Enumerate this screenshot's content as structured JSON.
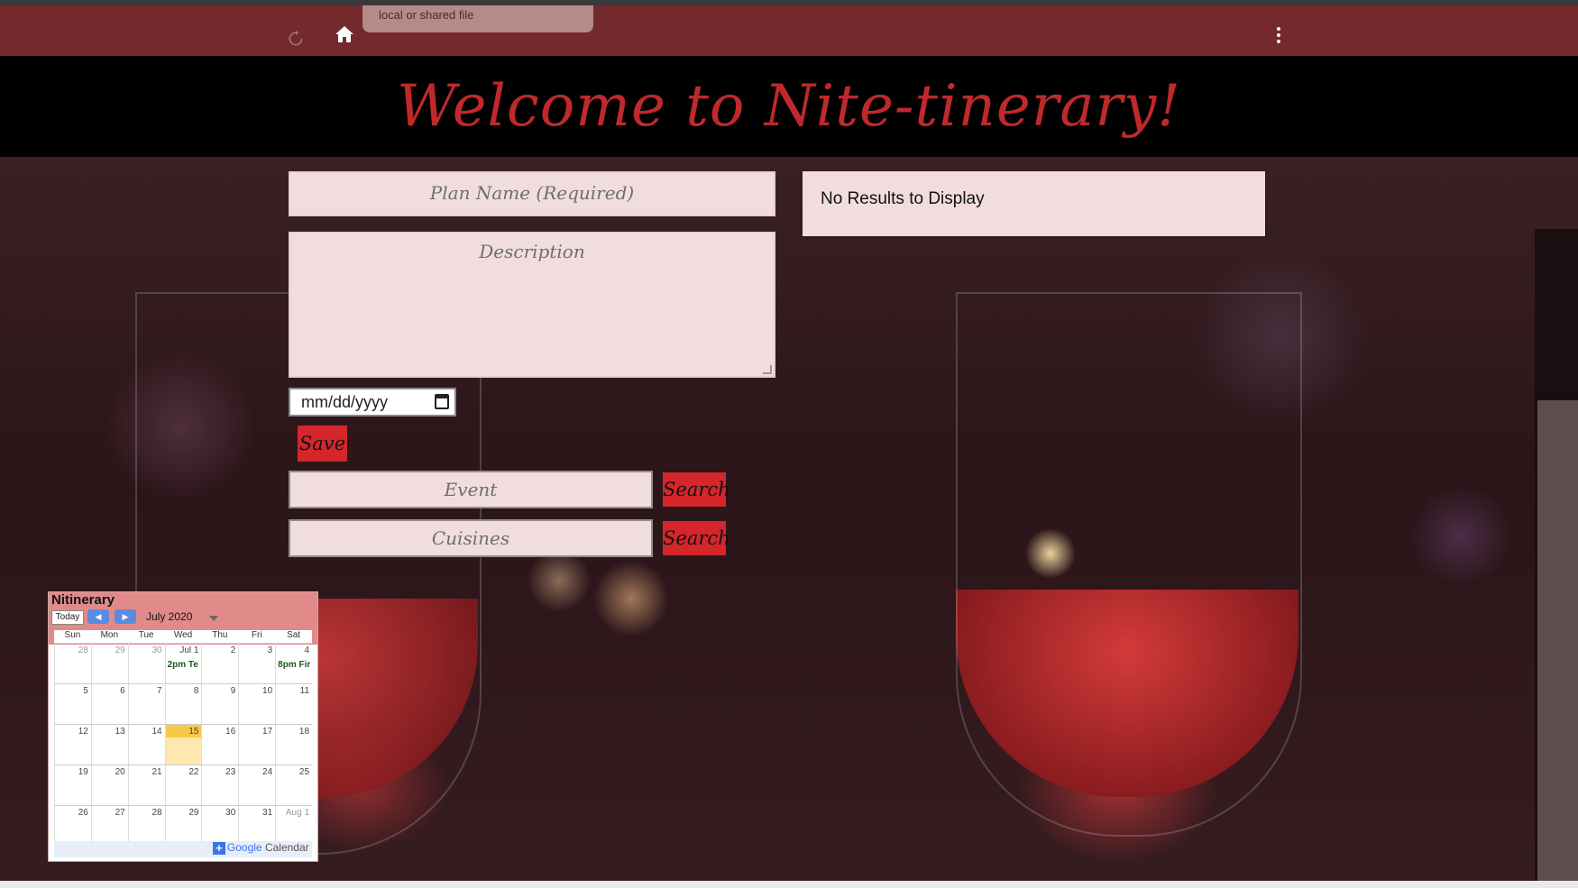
{
  "browser": {
    "tooltip_text": "local or shared file",
    "home_icon": "home-icon",
    "menu_icon": "kebab-menu-icon"
  },
  "header": {
    "title": "Welcome to Nite-tinerary!",
    "title_color": "#c0292c"
  },
  "form": {
    "plan_name_placeholder": "Plan Name (Required)",
    "description_placeholder": "Description",
    "date_value": "mm/dd/yyyy",
    "save_label": "Save",
    "event_placeholder": "Event",
    "cuisines_placeholder": "Cuisines",
    "search_label": "Search",
    "accent_color": "#d4262b"
  },
  "results": {
    "message": "No Results to Display"
  },
  "calendar": {
    "title": "Nitinerary",
    "today_label": "Today",
    "month_label": "July 2020",
    "days_of_week": [
      "Sun",
      "Mon",
      "Tue",
      "Wed",
      "Thu",
      "Fri",
      "Sat"
    ],
    "weeks": [
      [
        {
          "d": "28",
          "m": true
        },
        {
          "d": "29",
          "m": true
        },
        {
          "d": "30",
          "m": true
        },
        {
          "d": "Jul 1",
          "e": "2pm Te"
        },
        {
          "d": "2"
        },
        {
          "d": "3"
        },
        {
          "d": "4",
          "e": "8pm Fir"
        }
      ],
      [
        {
          "d": "5"
        },
        {
          "d": "6"
        },
        {
          "d": "7"
        },
        {
          "d": "8"
        },
        {
          "d": "9"
        },
        {
          "d": "10"
        },
        {
          "d": "11"
        }
      ],
      [
        {
          "d": "12"
        },
        {
          "d": "13"
        },
        {
          "d": "14"
        },
        {
          "d": "15",
          "t": true
        },
        {
          "d": "16"
        },
        {
          "d": "17"
        },
        {
          "d": "18"
        }
      ],
      [
        {
          "d": "19"
        },
        {
          "d": "20"
        },
        {
          "d": "21"
        },
        {
          "d": "22"
        },
        {
          "d": "23"
        },
        {
          "d": "24"
        },
        {
          "d": "25"
        }
      ],
      [
        {
          "d": "26"
        },
        {
          "d": "27"
        },
        {
          "d": "28"
        },
        {
          "d": "29"
        },
        {
          "d": "30"
        },
        {
          "d": "31"
        },
        {
          "d": "Aug 1",
          "m": true
        }
      ]
    ],
    "footer_google": "Google",
    "footer_calendar": "Calendar"
  }
}
